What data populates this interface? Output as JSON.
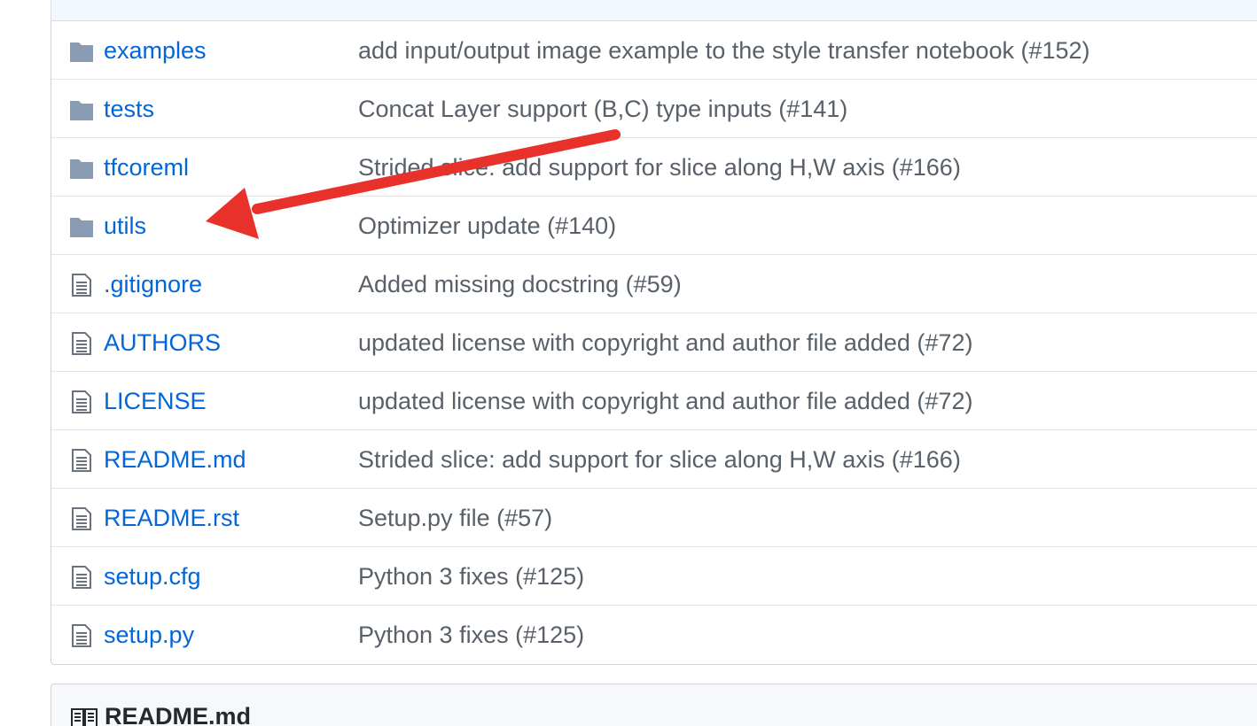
{
  "files": [
    {
      "name": "examples",
      "type": "folder",
      "message": "add input/output image example to the style transfer notebook (#152)"
    },
    {
      "name": "tests",
      "type": "folder",
      "message": "Concat Layer support (B,C) type inputs (#141)"
    },
    {
      "name": "tfcoreml",
      "type": "folder",
      "message": "Strided slice: add support for slice along H,W axis (#166)"
    },
    {
      "name": "utils",
      "type": "folder",
      "message": "Optimizer update (#140)"
    },
    {
      "name": ".gitignore",
      "type": "file",
      "message": "Added missing docstring (#59)"
    },
    {
      "name": "AUTHORS",
      "type": "file",
      "message": "updated license with copyright and author file added (#72)"
    },
    {
      "name": "LICENSE",
      "type": "file",
      "message": "updated license with copyright and author file added (#72)"
    },
    {
      "name": "README.md",
      "type": "file",
      "message": "Strided slice: add support for slice along H,W axis (#166)"
    },
    {
      "name": "README.rst",
      "type": "file",
      "message": "Setup.py file (#57)"
    },
    {
      "name": "setup.cfg",
      "type": "file",
      "message": "Python 3 fixes (#125)"
    },
    {
      "name": "setup.py",
      "type": "file",
      "message": "Python 3 fixes (#125)"
    }
  ],
  "readme": {
    "title": "README.md",
    "icon": "book-icon"
  },
  "icons": {
    "folder": "folder-icon",
    "file": "file-icon"
  },
  "colors": {
    "link": "#0366d6",
    "message": "#586069",
    "folder_icon": "#79b8ff",
    "annotation_arrow": "#e8312a"
  }
}
